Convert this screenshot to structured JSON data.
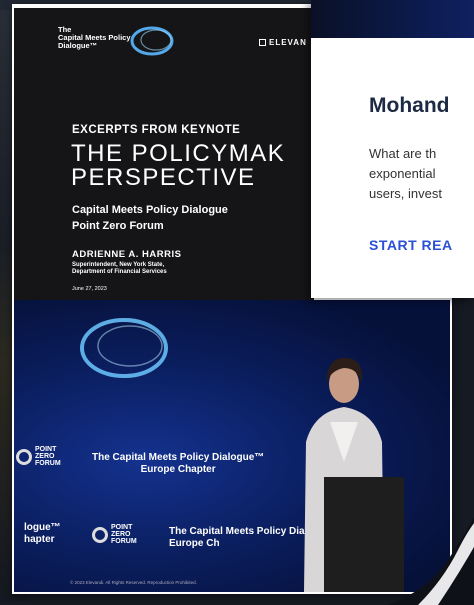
{
  "colors": {
    "doc_header_bg": "#151518",
    "card_title": "#1c2a44",
    "cta_blue": "#2b50d6",
    "stage_blue": "#0a1d5c"
  },
  "document": {
    "logo": {
      "line1": "The",
      "line2": "Capital Meets Policy",
      "line3": "Dialogue™",
      "icon": "swirl-logo-icon"
    },
    "partner": "ELEVAN",
    "kicker": "EXCERPTS FROM KEYNOTE",
    "title_line1": "THE POLICYMAK",
    "title_line2": "PERSPECTIVE",
    "subtitle_line1": "Capital Meets Policy Dialogue",
    "subtitle_line2": "Point Zero Forum",
    "speaker_name": "ADRIENNE A. HARRIS",
    "speaker_role_line1": "Superintendent, New York State,",
    "speaker_role_line2": "Department of Financial Services",
    "date": "June 27, 2023"
  },
  "photo": {
    "backdrop_line1": "The Capital Meets Policy Dialogue™",
    "backdrop_line2": "Europe Chapter",
    "backdrop2_line1": "The Capital Meets Policy Dial",
    "backdrop2_line2": "Europe Ch",
    "side_line1": "logue™",
    "side_line2": "hapter",
    "pz_label1": {
      "line1": "POINT",
      "line2": "ZERO",
      "line3": "FORUM"
    },
    "pz_label2": {
      "line1": "POINT",
      "line2": "ZERO",
      "line3": "FORUM"
    },
    "footer": "© 2023 Elevandi. All Rights Reserved. Reproduction Prohibited."
  },
  "card": {
    "title": "Mohand",
    "excerpt_line1": "What are th",
    "excerpt_line2": "exponential",
    "excerpt_line3": "users, invest",
    "cta": "START REA"
  }
}
